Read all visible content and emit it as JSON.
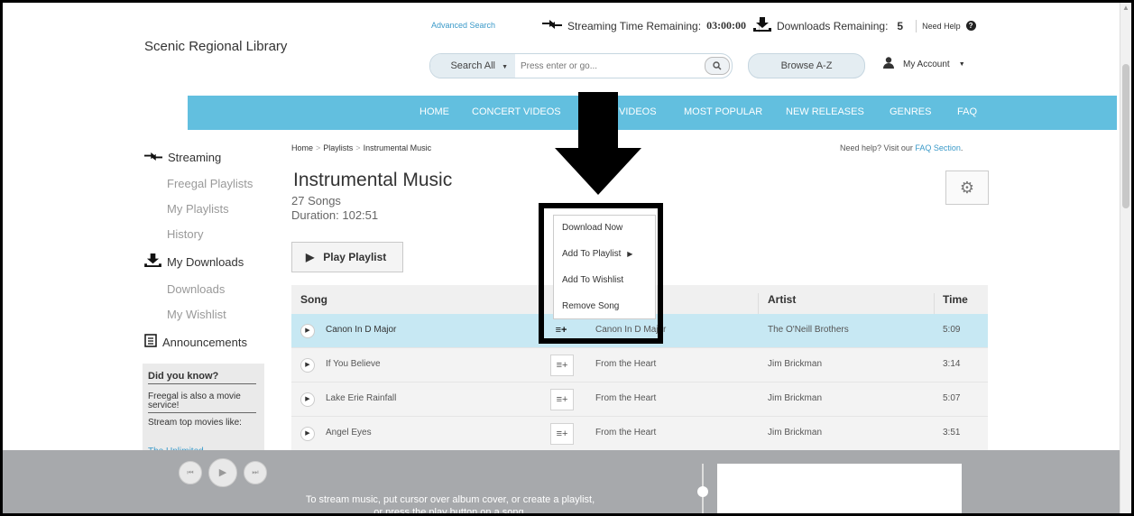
{
  "header": {
    "site_title": "Scenic Regional Library",
    "advanced_search": "Advanced Search",
    "streaming_label": "Streaming Time Remaining:",
    "streaming_value": "03:00:00",
    "downloads_label": "Downloads Remaining:",
    "downloads_value": "5",
    "need_help": "Need Help",
    "search_scope": "Search All",
    "search_placeholder": "Press enter or go...",
    "browse": "Browse A-Z",
    "my_account": "My Account"
  },
  "nav": {
    "items": [
      "HOME",
      "CONCERT VIDEOS",
      "MUSIC VIDEOS",
      "MOST POPULAR",
      "NEW RELEASES",
      "GENRES",
      "FAQ"
    ],
    "visible_music_videos": "C VIDEOS",
    "color": "#62bfdf"
  },
  "sidebar": {
    "streaming": "Streaming",
    "freegal_playlists": "Freegal Playlists",
    "my_playlists": "My Playlists",
    "history": "History",
    "my_downloads": "My Downloads",
    "downloads": "Downloads",
    "my_wishlist": "My Wishlist",
    "announcements": "Announcements",
    "did_you_know": "Did you know?",
    "did_you_know_p1": "Freegal is also a movie service!",
    "did_you_know_p2": "Stream top movies like:",
    "did_you_know_p3": "The Unlimited ..."
  },
  "breadcrumb": {
    "home": "Home",
    "playlists": "Playlists",
    "current": "Instrumental Music"
  },
  "help_text": {
    "prefix": "Need help? Visit our ",
    "link": "FAQ Section",
    "suffix": "."
  },
  "playlist": {
    "title": "Instrumental Music",
    "songs": "27 Songs",
    "duration": "Duration: 102:51",
    "play_button": "Play Playlist"
  },
  "table": {
    "headers": {
      "song": "Song",
      "artist": "Artist",
      "time": "Time"
    },
    "rows": [
      {
        "song": "Canon In D Major",
        "album": "Canon In D Major",
        "artist": "The O'Neill Brothers",
        "time": "5:09"
      },
      {
        "song": "If You Believe",
        "album": "From the Heart",
        "artist": "Jim Brickman",
        "time": "3:14"
      },
      {
        "song": "Lake Erie Rainfall",
        "album": "From the Heart",
        "artist": "Jim Brickman",
        "time": "5:07"
      },
      {
        "song": "Angel Eyes",
        "album": "From the Heart",
        "artist": "Jim Brickman",
        "time": "3:51"
      }
    ]
  },
  "dropdown": {
    "download_now": "Download Now",
    "add_to_playlist": "Add To Playlist",
    "add_to_wishlist": "Add To Wishlist",
    "remove_song": "Remove Song"
  },
  "player": {
    "message_line1": "To stream music, put cursor over album cover, or create a playlist,",
    "message_line2": "or press the play button on a song."
  },
  "icons": [
    "streaming-icon",
    "download-icon",
    "help-icon",
    "search-icon",
    "user-icon",
    "gear-icon",
    "play-icon",
    "add-to-playlist-icon",
    "announcements-icon",
    "prev-icon",
    "next-icon",
    "down-arrow-annotation-icon"
  ]
}
